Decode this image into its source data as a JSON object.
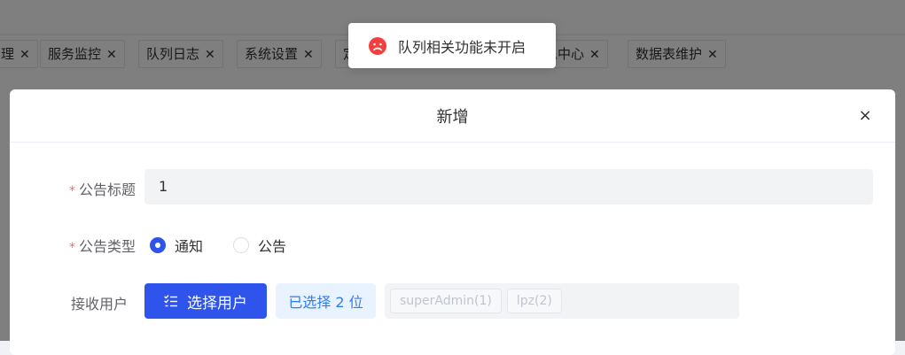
{
  "tabs": [
    {
      "label": "理"
    },
    {
      "label": "服务监控"
    },
    {
      "label": "队列日志"
    },
    {
      "label": "系统设置"
    },
    {
      "label": "定"
    },
    {
      "label": "息中心"
    },
    {
      "label": "数据表维护"
    }
  ],
  "toast": {
    "message": "队列相关功能未开启",
    "icon": "sad-face-icon",
    "color": "#f53f3f"
  },
  "dialog": {
    "title": "新增",
    "close_icon": "×",
    "fields": {
      "title": {
        "label": "公告标题",
        "required": true,
        "value": "1"
      },
      "type": {
        "label": "公告类型",
        "required": true,
        "options": [
          {
            "label": "通知",
            "checked": true
          },
          {
            "label": "公告",
            "checked": false
          }
        ]
      },
      "receivers": {
        "label": "接收用户",
        "button_label": "选择用户",
        "selected_text": "已选择 2 位",
        "users": [
          "superAdmin(1)",
          "lpz(2)"
        ]
      }
    }
  },
  "colors": {
    "primary": "#2f54eb",
    "error": "#f53f3f",
    "required": "#f56c6c"
  }
}
